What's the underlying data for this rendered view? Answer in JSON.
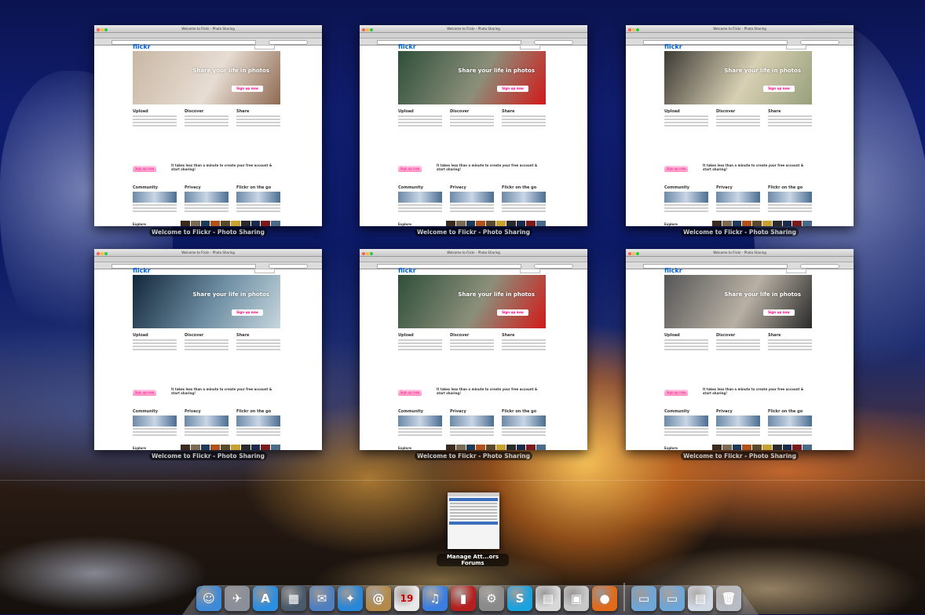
{
  "desktop": {
    "mode": "Exposé"
  },
  "windows": [
    {
      "title": "Welcome to Flickr - Photo Sharing",
      "hero": "puppy",
      "colors": [
        "#c9b7a4",
        "#e7ddd3",
        "#8f6a52"
      ]
    },
    {
      "title": "Welcome to Flickr - Photo Sharing",
      "hero": "red-shoes",
      "colors": [
        "#2f4f3a",
        "#8b8f7a",
        "#d21a1a"
      ]
    },
    {
      "title": "Welcome to Flickr - Photo Sharing",
      "hero": "camera",
      "colors": [
        "#3d3a34",
        "#d8d0b4",
        "#97a07a"
      ]
    },
    {
      "title": "Welcome to Flickr - Photo Sharing",
      "hero": "jumpers",
      "colors": [
        "#13283a",
        "#6f8fa4",
        "#c6d6dd"
      ]
    },
    {
      "title": "Welcome to Flickr - Photo Sharing",
      "hero": "red-shoes",
      "colors": [
        "#2f4f3a",
        "#8b8f7a",
        "#d21a1a"
      ]
    },
    {
      "title": "Welcome to Flickr - Photo Sharing",
      "hero": "polaroids",
      "colors": [
        "#565656",
        "#b8b0a4",
        "#2a2a2a"
      ]
    }
  ],
  "flickr": {
    "logo": "flickr",
    "tagline": "Share your life in photos",
    "signup": "Sign up now",
    "pitch": "It takes less than a minute to create your free account & start sharing!",
    "nav": "Sign In",
    "sections": [
      "Upload",
      "Discover",
      "Share"
    ],
    "sections2": [
      "Community",
      "Privacy",
      "Flickr on the go"
    ],
    "explore": "Explore"
  },
  "other_window": {
    "title": "Manage Att...ors Forums"
  },
  "dock": [
    {
      "name": "finder-icon",
      "glyph": "☺",
      "color": "#3f8ad8"
    },
    {
      "name": "launchpad-icon",
      "glyph": "✈",
      "color": "#8a8f9a"
    },
    {
      "name": "app-store-icon",
      "glyph": "A",
      "color": "#2d8ee0"
    },
    {
      "name": "mission-control-icon",
      "glyph": "▦",
      "color": "#4a5a6a"
    },
    {
      "name": "mail-icon",
      "glyph": "✉",
      "color": "#4f7fc0"
    },
    {
      "name": "safari-icon",
      "glyph": "✦",
      "color": "#2a86d6"
    },
    {
      "name": "address-book-icon",
      "glyph": "@",
      "color": "#b48a4a"
    },
    {
      "name": "calendar-icon",
      "glyph": "19",
      "color": "#e8e8e8"
    },
    {
      "name": "itunes-icon",
      "glyph": "♫",
      "color": "#3a7ee0"
    },
    {
      "name": "photo-booth-icon",
      "glyph": "▮",
      "color": "#b61f1f"
    },
    {
      "name": "system-preferences-icon",
      "glyph": "⚙",
      "color": "#8a8a8a"
    },
    {
      "name": "skype-icon",
      "glyph": "S",
      "color": "#1aa3e0"
    },
    {
      "name": "preview-icon",
      "glyph": "▤",
      "color": "#d8d8d8"
    },
    {
      "name": "image-capture-icon",
      "glyph": "▣",
      "color": "#c8c8c8"
    },
    {
      "name": "firefox-icon",
      "glyph": "●",
      "color": "#e06a1a"
    },
    {
      "name": "applications-folder-icon",
      "glyph": "▭",
      "color": "#6fa6d8"
    },
    {
      "name": "documents-folder-icon",
      "glyph": "▭",
      "color": "#6fa6d8"
    },
    {
      "name": "downloads-stack-icon",
      "glyph": "▤",
      "color": "#d0d8e4"
    },
    {
      "name": "trash-icon",
      "glyph": "🗑",
      "color": "#b8bcc4"
    }
  ]
}
